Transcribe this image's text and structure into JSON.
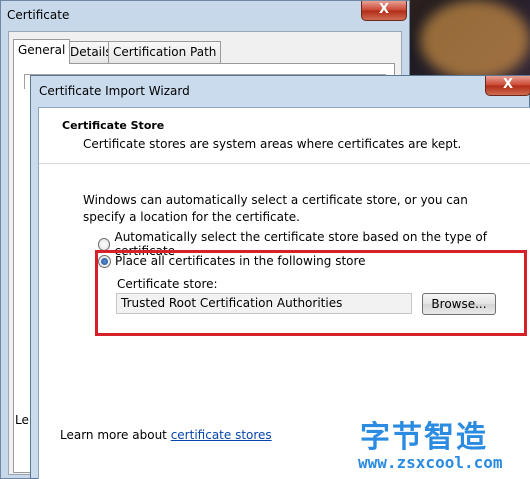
{
  "cert_window": {
    "title": "Certificate",
    "close_label": "X",
    "tabs": [
      {
        "label": "General",
        "active": true
      },
      {
        "label": "Details",
        "active": false
      },
      {
        "label": "Certification Path",
        "active": false
      }
    ],
    "footer_partial": "Le"
  },
  "wizard": {
    "title": "Certificate Import Wizard",
    "close_label": "X",
    "section_title": "Certificate Store",
    "section_subtitle": "Certificate stores are system areas where certificates are kept.",
    "description": "Windows can automatically select a certificate store, or you can specify a location for the certificate.",
    "options": [
      {
        "label": "Automatically select the certificate store based on the type of certificate",
        "checked": false
      },
      {
        "label": "Place all certificates in the following store",
        "checked": true
      }
    ],
    "store_label": "Certificate store:",
    "store_value": "Trusted Root Certification Authorities",
    "browse_label": "Browse...",
    "learn_prefix": "Learn more about ",
    "learn_link": "certificate stores"
  },
  "watermark": {
    "chinese": "字节智造",
    "url": "www.zsxcool.com"
  },
  "colors": {
    "highlight": "#d6202a",
    "link": "#0645ad",
    "watermark": "#2a8be0",
    "close_button": "#c8442f"
  },
  "icons": {
    "close": "close-icon"
  }
}
